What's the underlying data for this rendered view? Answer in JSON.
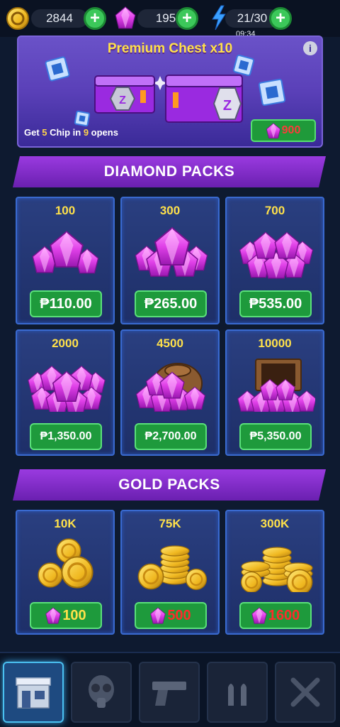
{
  "resources": {
    "coins": "2844",
    "gems": "195",
    "energy": "21/30",
    "energy_timer": "09:34"
  },
  "banner": {
    "title": "Premium Chest x10",
    "note_prefix": "Get ",
    "note_chip_count": "5",
    "note_mid": " Chip in ",
    "note_open_count": "9",
    "note_suffix": " opens",
    "price": "900"
  },
  "diamond_section": {
    "title": "DIAMOND PACKS",
    "packs": [
      {
        "amount": "100",
        "price": "₱110.00"
      },
      {
        "amount": "300",
        "price": "₱265.00"
      },
      {
        "amount": "700",
        "price": "₱535.00"
      },
      {
        "amount": "2000",
        "price": "₱1,350.00"
      },
      {
        "amount": "4500",
        "price": "₱2,700.00"
      },
      {
        "amount": "10000",
        "price": "₱5,350.00"
      }
    ]
  },
  "gold_section": {
    "title": "GOLD PACKS",
    "packs": [
      {
        "amount": "10K",
        "price": "100"
      },
      {
        "amount": "75K",
        "price": "500"
      },
      {
        "amount": "300K",
        "price": "1600"
      }
    ]
  },
  "nav": [
    "shop-icon",
    "gas-mask-icon",
    "pistol-icon",
    "bullets-icon",
    "crossed-knives-icon"
  ],
  "colors": {
    "accent_yellow": "#ffe14a",
    "price_green": "#1e9a3c",
    "gem_pink": "#e040e8",
    "header_purple": "#8a30d8"
  }
}
